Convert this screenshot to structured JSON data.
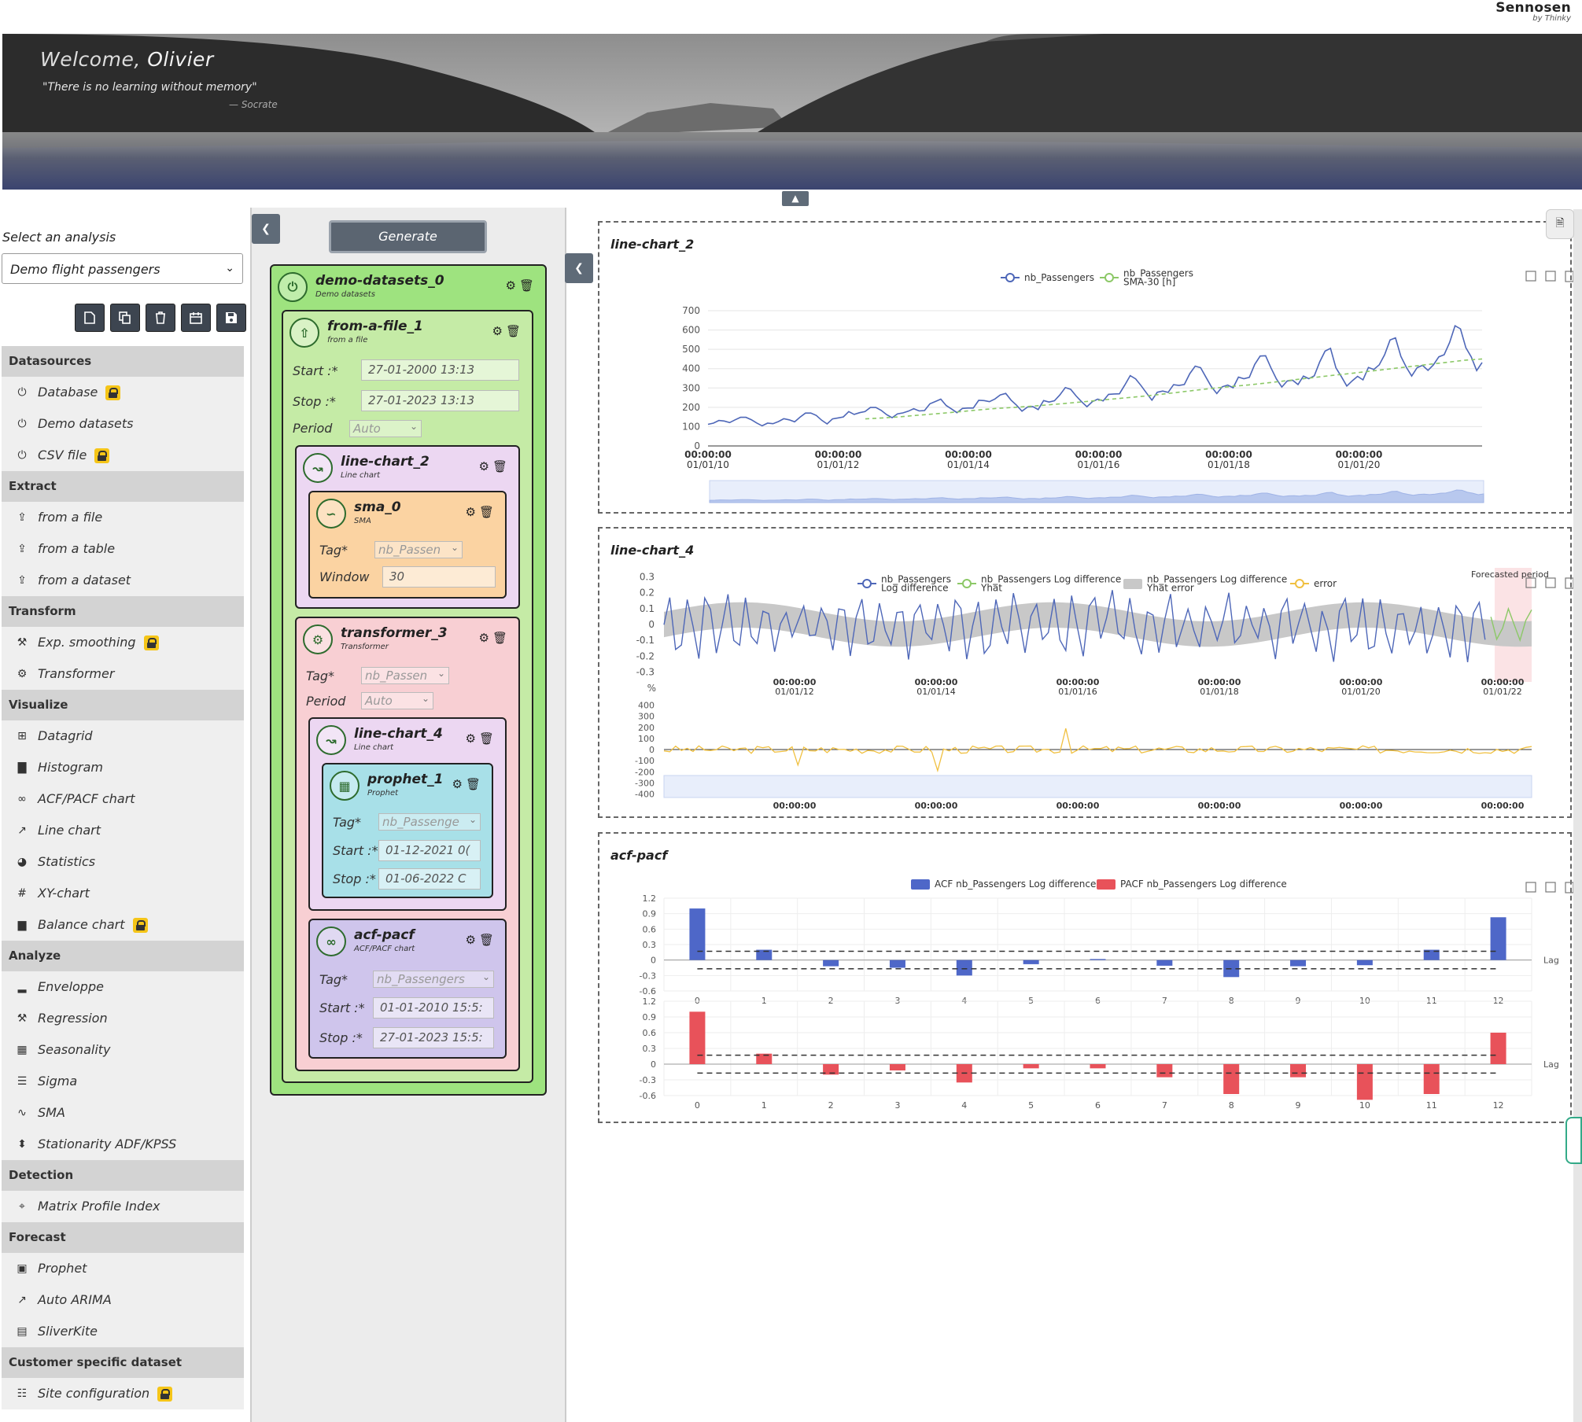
{
  "brand": {
    "name": "Sennosen",
    "by": "by Thinky"
  },
  "hero": {
    "welcome_prefix": "Welcome,",
    "user": "Olivier",
    "quote": "\"There is no learning without memory\"",
    "author": "— Socrate"
  },
  "sidebar": {
    "select_label": "Select an analysis",
    "selected_analysis": "Demo flight passengers",
    "toolbar": [
      "new-file-icon",
      "copy-icon",
      "trash-icon",
      "calendar-icon",
      "save-icon"
    ],
    "sections": [
      {
        "title": "Datasources",
        "items": [
          {
            "label": "Database",
            "icon": "plug-icon",
            "locked": true
          },
          {
            "label": "Demo datasets",
            "icon": "plug-icon",
            "locked": false
          },
          {
            "label": "CSV file",
            "icon": "plug-icon",
            "locked": true
          }
        ]
      },
      {
        "title": "Extract",
        "items": [
          {
            "label": "from a file",
            "icon": "upload-icon",
            "locked": false
          },
          {
            "label": "from a table",
            "icon": "upload-icon",
            "locked": false
          },
          {
            "label": "from a dataset",
            "icon": "upload-icon",
            "locked": false
          }
        ]
      },
      {
        "title": "Transform",
        "items": [
          {
            "label": "Exp. smoothing",
            "icon": "tools-icon",
            "locked": true
          },
          {
            "label": "Transformer",
            "icon": "cogs-icon",
            "locked": false
          }
        ]
      },
      {
        "title": "Visualize",
        "items": [
          {
            "label": "Datagrid",
            "icon": "grid-icon",
            "locked": false
          },
          {
            "label": "Histogram",
            "icon": "histogram-icon",
            "locked": false
          },
          {
            "label": "ACF/PACF chart",
            "icon": "infinity-icon",
            "locked": false
          },
          {
            "label": "Line chart",
            "icon": "line-chart-icon",
            "locked": false
          },
          {
            "label": "Statistics",
            "icon": "pie-icon",
            "locked": false
          },
          {
            "label": "XY-chart",
            "icon": "hash-icon",
            "locked": false
          },
          {
            "label": "Balance chart",
            "icon": "bar-chart-icon",
            "locked": true
          }
        ]
      },
      {
        "title": "Analyze",
        "items": [
          {
            "label": "Enveloppe",
            "icon": "signal-icon",
            "locked": false
          },
          {
            "label": "Regression",
            "icon": "wrench-icon",
            "locked": false
          },
          {
            "label": "Seasonality",
            "icon": "calendar-icon",
            "locked": false
          },
          {
            "label": "Sigma",
            "icon": "list-icon",
            "locked": false
          },
          {
            "label": "SMA",
            "icon": "wave-icon",
            "locked": false
          },
          {
            "label": "Stationarity ADF/KPSS",
            "icon": "sort-icon",
            "locked": false
          }
        ]
      },
      {
        "title": "Detection",
        "items": [
          {
            "label": "Matrix Profile Index",
            "icon": "crosshair-icon",
            "locked": false
          }
        ]
      },
      {
        "title": "Forecast",
        "items": [
          {
            "label": "Prophet",
            "icon": "prophet-icon",
            "locked": false
          },
          {
            "label": "Auto ARIMA",
            "icon": "line-chart-icon",
            "locked": false
          },
          {
            "label": "SliverKite",
            "icon": "square-chart-icon",
            "locked": false
          }
        ]
      },
      {
        "title": "Customer specific dataset",
        "items": [
          {
            "label": "Site configuration",
            "icon": "sitemap-icon",
            "locked": true
          }
        ]
      }
    ]
  },
  "pipeline": {
    "generate_label": "Generate",
    "nodes": {
      "demo": {
        "title": "demo-datasets_0",
        "subtitle": "Demo datasets",
        "color": "#9ee37f"
      },
      "file": {
        "title": "from-a-file_1",
        "subtitle": "from a file",
        "color": "#c5eba6",
        "start_label": "Start :*",
        "start": "27-01-2000 13:13",
        "stop_label": "Stop :*",
        "stop": "27-01-2023 13:13",
        "period_label": "Period",
        "period": "Auto"
      },
      "lc2": {
        "title": "line-chart_2",
        "subtitle": "Line chart",
        "color": "#ecd7f2"
      },
      "sma": {
        "title": "sma_0",
        "subtitle": "SMA",
        "color": "#fbd3a2",
        "tag_label": "Tag*",
        "tag": "nb_Passen",
        "window_label": "Window",
        "window": "30"
      },
      "tr": {
        "title": "transformer_3",
        "subtitle": "Transformer",
        "color": "#f8cfd3",
        "tag_label": "Tag*",
        "tag": "nb_Passen",
        "period_label": "Period",
        "period": "Auto"
      },
      "lc4": {
        "title": "line-chart_4",
        "subtitle": "Line chart",
        "color": "#ecd7f2"
      },
      "prophet": {
        "title": "prophet_1",
        "subtitle": "Prophet",
        "color": "#a8e0e8",
        "tag_label": "Tag*",
        "tag": "nb_Passenge",
        "start_label": "Start :*",
        "start": "01-12-2021 0(",
        "stop_label": "Stop :*",
        "stop": "01-06-2022 C"
      },
      "acf": {
        "title": "acf-pacf",
        "subtitle": "ACF/PACF chart",
        "color": "#cfc5ec",
        "tag_label": "Tag*",
        "tag": "nb_Passengers",
        "start_label": "Start :*",
        "start": "01-01-2010 15:5:",
        "stop_label": "Stop :*",
        "stop": "27-01-2023 15:5:"
      }
    }
  },
  "charts": {
    "lc2": {
      "title": "line-chart_2"
    },
    "lc4": {
      "title": "line-chart_4"
    },
    "acf": {
      "title": "acf-pacf"
    }
  },
  "chart_data": [
    {
      "type": "line",
      "title": "line-chart_2",
      "legend": [
        "nb_Passengers",
        "nb_Passengers SMA-30 [h]"
      ],
      "x_ticks": [
        "00:00:00 01/01/10",
        "00:00:00 01/01/12",
        "00:00:00 01/01/14",
        "00:00:00 01/01/16",
        "00:00:00 01/01/18",
        "00:00:00 01/01/20"
      ],
      "y_ticks": [
        0,
        100,
        200,
        300,
        400,
        500,
        600,
        700
      ],
      "ylim": [
        0,
        700
      ],
      "series": [
        {
          "name": "nb_Passengers",
          "color": "#4e67b8",
          "values": [
            112,
            118,
            132,
            129,
            121,
            135,
            148,
            148,
            136,
            119,
            104,
            118,
            115,
            126,
            141,
            135,
            125,
            149,
            170,
            170,
            158,
            133,
            114,
            140,
            145,
            150,
            178,
            163,
            172,
            178,
            199,
            199,
            184,
            162,
            146,
            166,
            171,
            180,
            193,
            181,
            183,
            218,
            230,
            242,
            209,
            191,
            172,
            194,
            196,
            196,
            236,
            235,
            229,
            243,
            264,
            272,
            237,
            211,
            180,
            201,
            204,
            188,
            235,
            227,
            234,
            264,
            302,
            293,
            259,
            229,
            203,
            229,
            242,
            233,
            267,
            269,
            270,
            315,
            364,
            347,
            312,
            274,
            237,
            278,
            284,
            277,
            317,
            313,
            318,
            374,
            413,
            405,
            355,
            306,
            271,
            306,
            315,
            301,
            356,
            348,
            355,
            422,
            465,
            467,
            404,
            347,
            305,
            336,
            340,
            318,
            362,
            348,
            363,
            435,
            491,
            505,
            404,
            359,
            310,
            337,
            360,
            342,
            406,
            396,
            420,
            472,
            548,
            559,
            463,
            407,
            362,
            405,
            417,
            391,
            419,
            461,
            472,
            535,
            622,
            606,
            508,
            461,
            390,
            432
          ]
        },
        {
          "name": "nb_Passengers SMA-30 [h]",
          "color": "#8cc867",
          "dashed": true,
          "values": [
            140,
            145,
            150,
            158,
            165,
            172,
            180,
            188,
            195,
            200,
            206,
            213,
            220,
            228,
            236,
            244,
            252,
            260,
            270,
            280,
            290,
            300,
            308,
            316,
            325,
            335,
            345,
            355,
            365,
            374,
            384,
            394,
            404,
            414,
            424,
            434,
            444,
            450
          ]
        }
      ]
    },
    {
      "type": "line",
      "title": "line-chart_4",
      "legend": [
        "nb_Passengers Log difference",
        "nb_Passengers Log difference Yhat",
        "nb_Passengers Log difference Yhat error",
        "error"
      ],
      "annotation": "Forecasted period",
      "x_ticks": [
        "00:00:00 01/01/12",
        "00:00:00 01/01/14",
        "00:00:00 01/01/16",
        "00:00:00 01/01/18",
        "00:00:00 01/01/20",
        "00:00:00 01/01/22"
      ],
      "y_ticks_top": [
        0.3,
        0.2,
        0.1,
        0,
        -0.1,
        -0.2,
        -0.3
      ],
      "y_ticks_bottom": [
        400,
        300,
        200,
        100,
        0,
        -100,
        -200,
        -300,
        -400
      ],
      "y_unit": "%"
    },
    {
      "type": "bar",
      "title": "acf-pacf",
      "legend": [
        "ACF nb_Passengers Log difference",
        "PACF nb_Passengers Log difference"
      ],
      "categories": [
        0,
        1,
        2,
        3,
        4,
        5,
        6,
        7,
        8,
        9,
        10,
        11,
        12
      ],
      "xlabel": "Lag",
      "y_ticks": [
        1.2,
        0.9,
        0.6,
        0.3,
        0,
        -0.3,
        -0.6
      ],
      "ylim": [
        -0.6,
        1.2
      ],
      "series": [
        {
          "name": "ACF nb_Passengers Log difference",
          "color": "#4e67c8",
          "values": [
            1.0,
            0.2,
            -0.12,
            -0.15,
            -0.3,
            -0.08,
            0.02,
            -0.11,
            -0.33,
            -0.12,
            -0.1,
            0.2,
            0.83
          ],
          "conf": 0.17
        },
        {
          "name": "PACF nb_Passengers Log difference",
          "color": "#e8525a",
          "values": [
            1.0,
            0.2,
            -0.2,
            -0.12,
            -0.35,
            -0.08,
            -0.08,
            -0.25,
            -0.57,
            -0.25,
            -0.68,
            -0.57,
            0.6
          ],
          "conf": 0.17
        }
      ]
    }
  ]
}
